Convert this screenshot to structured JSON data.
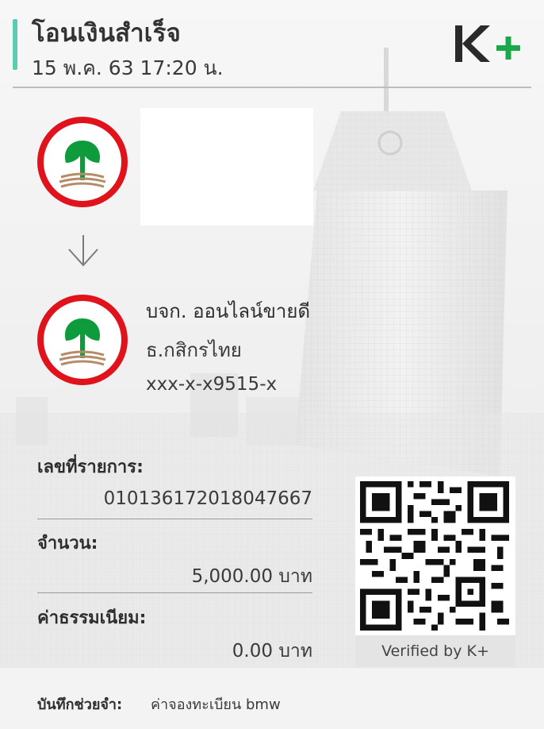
{
  "header": {
    "title": "โอนเงินสำเร็จ",
    "datetime": "15 พ.ค. 63  17:20 น.",
    "accent_color": "#5ccbb0",
    "logo": {
      "text_k": "K",
      "text_plus": "+",
      "dark_color": "#2a2a2a",
      "plus_color": "#1aa84a"
    }
  },
  "sender": {
    "logo_icon": "kasikornbank-logo-icon",
    "name_redacted": true
  },
  "arrow_icon": "arrow-down-icon",
  "receiver": {
    "logo_icon": "kasikornbank-logo-icon",
    "name": "บจก. ออนไลน์ขายดี",
    "bank": "ธ.กสิกรไทย",
    "account": "xxx-x-x9515-x"
  },
  "details": {
    "ref_label": "เลขที่รายการ:",
    "ref_value": "010136172018047667",
    "amount_label": "จำนวน:",
    "amount_value": "5,000.00 บาท",
    "fee_label": "ค่าธรรมเนียม:",
    "fee_value": "0.00 บาท"
  },
  "qr": {
    "icon": "qr-code-icon",
    "caption": "Verified by K+"
  },
  "memo": {
    "label": "บันทึกช่วยจำ:",
    "value": "ค่าจองทะเบียน bmw"
  },
  "colors": {
    "bank_green": "#0d9b3c",
    "bank_red": "#e0121b"
  }
}
